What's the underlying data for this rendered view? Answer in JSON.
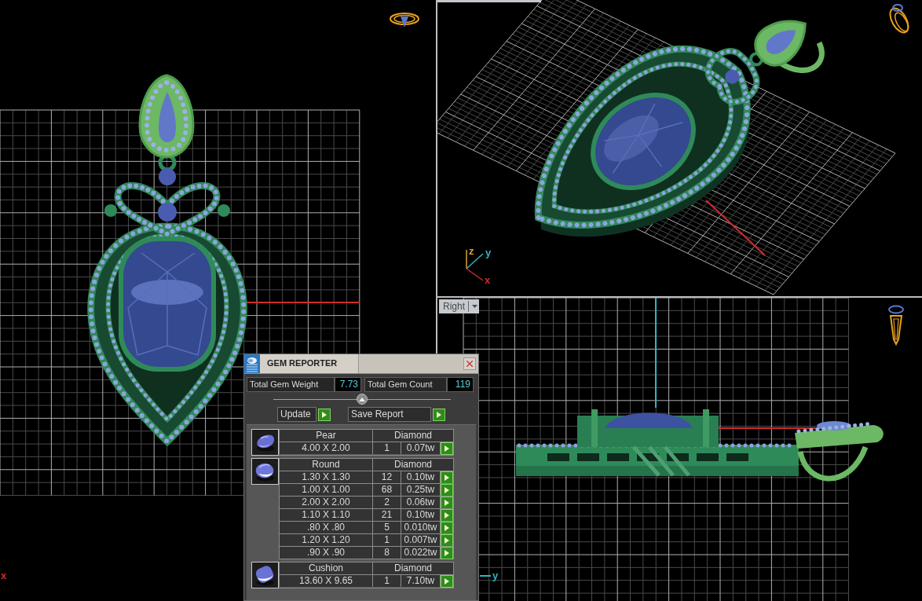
{
  "top_view": {
    "axis_labels": [
      {
        "text": "x",
        "color": "#d22b2b"
      }
    ]
  },
  "perspective_view": {
    "axis_labels": [
      {
        "text": "z",
        "color": "#d9a23a"
      },
      {
        "text": "y",
        "color": "#2fb4c4"
      },
      {
        "text": "x",
        "color": "#d22b2b"
      }
    ]
  },
  "right_view": {
    "view_menu": "Right",
    "axis_labels": [
      {
        "text": "y",
        "color": "#2fb4c4"
      }
    ]
  },
  "gem_reporter": {
    "title": "GEM REPORTER",
    "total_weight_label": "Total Gem Weight",
    "total_weight": "7.73",
    "total_count_label": "Total Gem Count",
    "total_count": "119",
    "buttons": [
      "Update",
      "Save Report"
    ],
    "groups": [
      {
        "kind": "pear",
        "shape": "Pear",
        "material": "Diamond",
        "rows": [
          {
            "size": "4.00 X 2.00",
            "count": "1",
            "weight": "0.07tw"
          }
        ]
      },
      {
        "kind": "round",
        "shape": "Round",
        "material": "Diamond",
        "rows": [
          {
            "size": "1.30 X 1.30",
            "count": "12",
            "weight": "0.10tw"
          },
          {
            "size": "1.00 X 1.00",
            "count": "68",
            "weight": "0.25tw"
          },
          {
            "size": "2.00 X 2.00",
            "count": "2",
            "weight": "0.06tw"
          },
          {
            "size": "1.10 X 1.10",
            "count": "21",
            "weight": "0.10tw"
          },
          {
            "size": ".80 X .80",
            "count": "5",
            "weight": "0.010tw"
          },
          {
            "size": "1.20 X 1.20",
            "count": "1",
            "weight": "0.007tw"
          },
          {
            "size": ".90 X .90",
            "count": "8",
            "weight": "0.022tw"
          }
        ]
      },
      {
        "kind": "cushion",
        "shape": "Cushion",
        "material": "Diamond",
        "rows": [
          {
            "size": "13.60 X 9.65",
            "count": "1",
            "weight": "7.10tw"
          }
        ]
      }
    ]
  }
}
